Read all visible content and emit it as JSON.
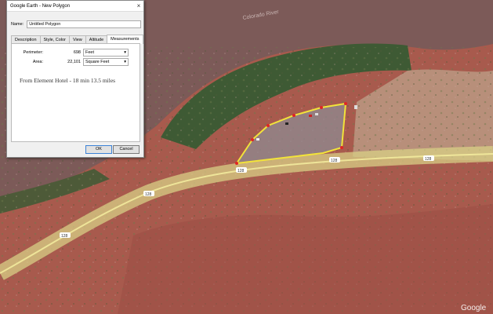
{
  "window": {
    "title": "Google Earth - New Polygon",
    "close_glyph": "×"
  },
  "form": {
    "name_label": "Name:",
    "name_value": "Untitled Polygon"
  },
  "tabs": [
    {
      "label": "Description"
    },
    {
      "label": "Style, Color"
    },
    {
      "label": "View"
    },
    {
      "label": "Altitude"
    },
    {
      "label": "Measurements",
      "active": true
    }
  ],
  "measurements": {
    "perimeter": {
      "label": "Perimeter:",
      "value": "698",
      "unit": "Feet"
    },
    "area": {
      "label": "Area:",
      "value": "22,101",
      "unit": "Square Feet"
    },
    "note": "From Element Hotel - 18 min 13.5 miles"
  },
  "buttons": {
    "ok": "OK",
    "cancel": "Cancel"
  },
  "map": {
    "river_label": "Colorado River",
    "route_number": "128",
    "watermark": "Google",
    "colors": {
      "river": "#7c5a58",
      "polygon": "#f2e33a",
      "vertex": "#e02424"
    }
  }
}
